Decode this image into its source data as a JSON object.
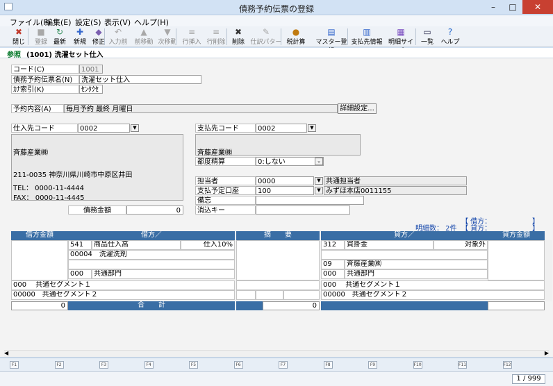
{
  "window": {
    "title": "債務予約伝票の登録",
    "min": "–",
    "max": "□",
    "close": "✕"
  },
  "menu": [
    "ファイル(F)",
    "編集(E)",
    "設定(S)",
    "表示(V)",
    "ヘルプ(H)"
  ],
  "toolbar": [
    {
      "label": "閉じる",
      "icon": "close-icon",
      "glyph": "✖",
      "enabled": true
    },
    {
      "label": "登録",
      "icon": "save-icon",
      "glyph": "■",
      "enabled": false
    },
    {
      "label": "最新",
      "icon": "refresh-icon",
      "glyph": "↻",
      "enabled": true
    },
    {
      "label": "新規",
      "icon": "new-document-icon",
      "glyph": "✚",
      "enabled": true
    },
    {
      "label": "修正",
      "icon": "eraser-icon",
      "glyph": "◆",
      "enabled": true
    },
    {
      "label": "入力前",
      "icon": "undo-icon",
      "glyph": "↶",
      "enabled": false
    },
    {
      "label": "前移動",
      "icon": "up-arrow-icon",
      "glyph": "▲",
      "enabled": false
    },
    {
      "label": "次移動",
      "icon": "down-arrow-icon",
      "glyph": "▼",
      "enabled": false
    },
    {
      "label": "行挿入",
      "icon": "insert-row-icon",
      "glyph": "≡",
      "enabled": false
    },
    {
      "label": "行削除",
      "icon": "delete-row-icon",
      "glyph": "≡",
      "enabled": false
    },
    {
      "label": "削除",
      "icon": "delete-icon",
      "glyph": "✖",
      "enabled": true
    },
    {
      "label": "仕訳パターン",
      "icon": "pen-icon",
      "glyph": "✎",
      "enabled": false
    },
    {
      "label": "税計算",
      "icon": "tax-calc-icon",
      "glyph": "●",
      "enabled": true
    },
    {
      "label": "マスター登録",
      "icon": "master-icon",
      "glyph": "▤",
      "enabled": true
    },
    {
      "label": "支払先情報",
      "icon": "chart-icon",
      "glyph": "▥",
      "enabled": true
    },
    {
      "label": "明細サイズ",
      "icon": "detail-size-icon",
      "glyph": "▦",
      "enabled": true
    },
    {
      "label": "一覧",
      "icon": "list-icon",
      "glyph": "▭",
      "enabled": true
    },
    {
      "label": "ヘルプ",
      "icon": "help-icon",
      "glyph": "?",
      "enabled": true
    }
  ],
  "breadcrumb": {
    "mode": "参照",
    "title": "(1001) 洗濯セット仕入"
  },
  "header": {
    "code_label": "コード(C)",
    "code": "1001",
    "name_label": "債務予約伝票名(N)",
    "name": "洗濯セット仕入",
    "kana_label": "ｶﾅ索引(K)",
    "kana": "ｾﾝﾀｸｾ",
    "content_label": "予約内容(A)",
    "content": "毎月予約 最終 月曜日",
    "detail_btn": "詳細設定..."
  },
  "supplier": {
    "code_label": "仕入先コード",
    "code": "0002",
    "name": "斉藤産業㈱",
    "address": "211-0035 神奈川県川崎市中原区井田",
    "tel": "TEL： 0000-11-4444",
    "fax": "FAX： 0000-11-4445",
    "debt_label": "債務金額",
    "debt": "0"
  },
  "payee": {
    "code_label": "支払先コード",
    "code": "0002",
    "name": "斉藤産業㈱",
    "settle_label": "都度精算",
    "settle": "0:しない",
    "staff_label": "担当者",
    "staff_code": "0000",
    "staff_name": "共通担当者",
    "account_label": "支払予定口座",
    "account_code": "100",
    "account_name": "みずほ本店0011155",
    "memo_label": "備忘",
    "memo": "",
    "key_label": "消込キー",
    "key": ""
  },
  "summary": {
    "debit_line": "【 借方：",
    "credit_line": "【 貸方：",
    "close": "】",
    "detail_count": "明細数：  2件"
  },
  "grid": {
    "headers": {
      "debit_amount": "借方金額",
      "debit": "借方／",
      "desc": "摘　　要",
      "credit": "貸方／",
      "credit_amount": "貸方金額"
    },
    "debit": {
      "account_code": "541",
      "account": "商品仕入高",
      "tax": "仕入10%",
      "sub_code": "00004",
      "sub": "洗濯洗剤",
      "dept_code": "000",
      "dept": "共通部門"
    },
    "credit": {
      "account_code": "312",
      "account": "買掛金",
      "tax": "対象外",
      "partner_code": "09",
      "partner": "斉藤産業㈱",
      "dept_code": "000",
      "dept": "共通部門"
    },
    "seg1": "000　 共通セグメント１",
    "seg2": "00000　共通セグメント２",
    "total_label": "合　　計",
    "debit_total": "0",
    "desc_total": "0"
  },
  "fkeys": [
    "F1",
    "F2",
    "F3",
    "F4",
    "F5",
    "F6",
    "F7",
    "F8",
    "F9",
    "F10",
    "F11",
    "F12"
  ],
  "status": {
    "page": "1 / 999"
  }
}
